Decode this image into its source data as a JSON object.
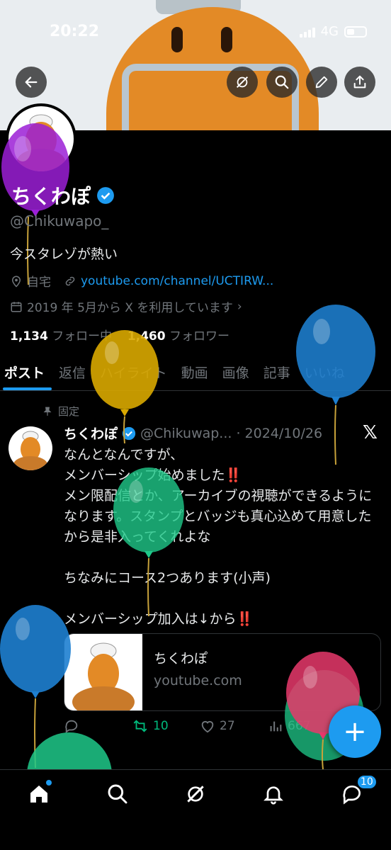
{
  "status_bar": {
    "time": "20:22",
    "network": "4G"
  },
  "profile": {
    "name": "ちくわぽ",
    "handle": "@Chikuwapo_",
    "bio": "今スタレゾが熱い",
    "location": "自宅",
    "link": "youtube.com/channel/UCTIRW...",
    "joined": "2019 年 5月から X を利用しています",
    "following_count": "1,134",
    "following_label": "フォロー中",
    "followers_count": "1,460",
    "followers_label": "フォロワー"
  },
  "tabs": [
    "ポスト",
    "返信",
    "ハイライト",
    "動画",
    "画像",
    "記事",
    "いいね"
  ],
  "post": {
    "pinned_label": "固定",
    "author": "ちくわぽ",
    "handle_date": "@Chikuwap... · 2024/10/26",
    "lines": [
      "なんとなんですが、",
      "メンバーシップ始めました",
      "メン限配信とか、アーカイブの視聴ができるようになります。スタンプとバッジも真心込めて用意したから是非入ってくれよな",
      "",
      "ちなみにコース2つあります(小声)",
      "",
      "メンバーシップ加入は↓から"
    ],
    "exclaim": "‼️",
    "card": {
      "title": "ちくわぽ",
      "domain": "youtube.com"
    },
    "retweets": "10",
    "likes": "27",
    "views": "667"
  },
  "fab_label": "+",
  "nav": {
    "messages_badge": "10"
  },
  "colors": {
    "accent": "#1d9bf0",
    "retweet": "#00ba7c",
    "background": "#000000"
  }
}
